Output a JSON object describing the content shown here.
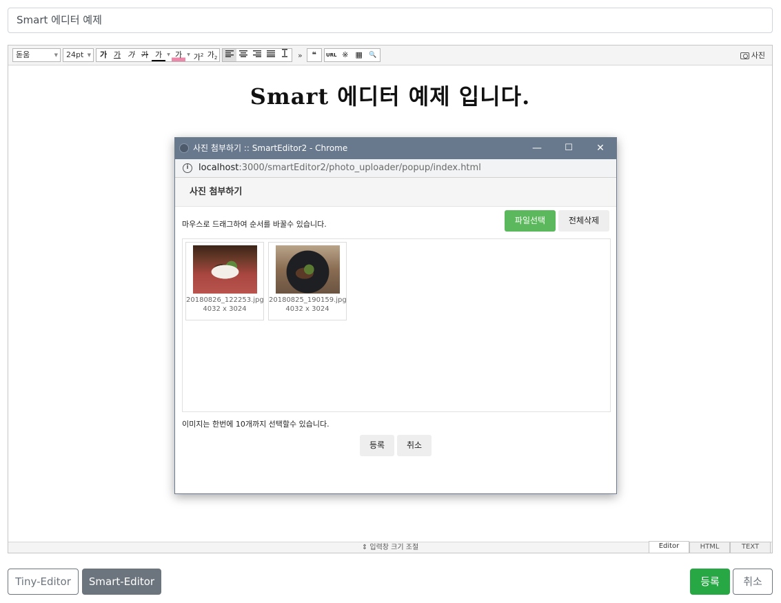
{
  "title_input": {
    "value": "Smart 에디터 예제"
  },
  "toolbar": {
    "font_family": "돋움",
    "font_size": "24pt",
    "style_buttons": [
      "가",
      "가",
      "가",
      "가",
      "가"
    ],
    "color_button": "가",
    "super_button": "가",
    "sub_button": "가",
    "more": "»",
    "quote": "❝",
    "url": "URL",
    "special_char": "※",
    "table": "▦",
    "find": "🔍",
    "photo_label": "사진"
  },
  "editor": {
    "heading": "Smart 에디터 예제 입니다.",
    "resize_label": "⇕ 입력창 크기 조절",
    "modes": [
      "Editor",
      "HTML",
      "TEXT"
    ]
  },
  "popup": {
    "window_title": "사진 첨부하기 :: SmartEditor2 - Chrome",
    "url_host": "localhost",
    "url_path": ":3000/smartEditor2/photo_uploader/popup/index.html",
    "header": "사진 첨부하기",
    "drag_info": "마우스로 드래그하여 순서를 바꿀수 있습니다.",
    "select_file": "파일선택",
    "delete_all": "전체삭제",
    "photos": [
      {
        "name": "20180826_122253.jpg",
        "size": "4032 x 3024"
      },
      {
        "name": "20180825_190159.jpg",
        "size": "4032 x 3024"
      }
    ],
    "limit_info": "이미지는 한번에 10개까지 선택할수 있습니다.",
    "submit": "등록",
    "cancel": "취소",
    "minimize": "—",
    "maximize": "☐",
    "close": "✕"
  },
  "bottom": {
    "tiny_editor": "Tiny-Editor",
    "smart_editor": "Smart-Editor",
    "submit": "등록",
    "cancel": "취소"
  },
  "colors": {
    "green": "#28a745",
    "popup_green": "#5cb85c",
    "secondary": "#6c757d",
    "titlebar": "#68798e"
  }
}
